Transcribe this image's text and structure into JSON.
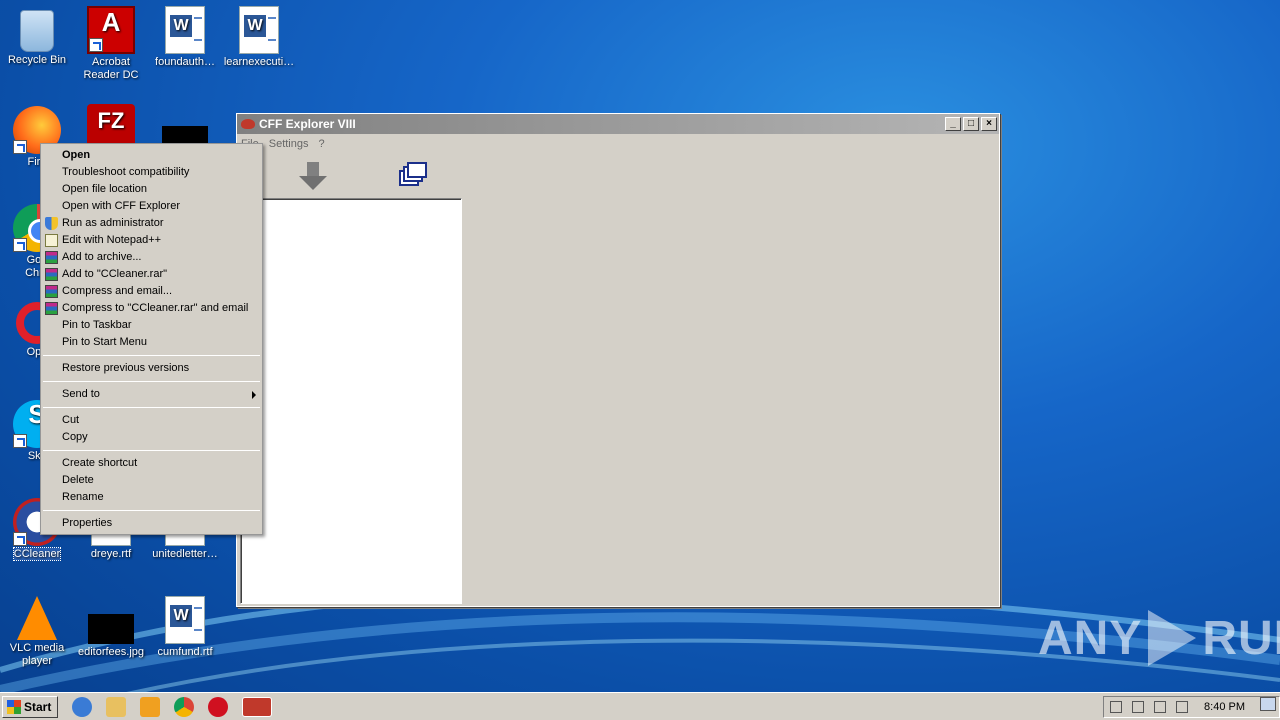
{
  "desktop": {
    "icons": {
      "recycle": "Recycle Bin",
      "acrobat_l1": "Acrobat",
      "acrobat_l2": "Reader DC",
      "foundauth": "foundauth…",
      "learnexec": "learnexecuti…",
      "firefox": "Fire",
      "chrome_l1": "Goo",
      "chrome_l2": "Chro",
      "opera": "Ope",
      "skype": "Sky",
      "ccleaner": "CCleaner",
      "dreye": "dreye.rtf",
      "unitedletter": "unitedletter…",
      "vlc_l1": "VLC media",
      "vlc_l2": "player",
      "editorfees": "editorfees.jpg",
      "cumfund": "cumfund.rtf"
    }
  },
  "window": {
    "title": "CFF Explorer VIII",
    "menu": [
      "File",
      "Settings",
      "?"
    ]
  },
  "context_menu": {
    "items": {
      "open": "Open",
      "troubleshoot": "Troubleshoot compatibility",
      "open_location": "Open file location",
      "open_cff": "Open with CFF Explorer",
      "run_admin": "Run as administrator",
      "edit_npp": "Edit with Notepad++",
      "add_archive": "Add to archive...",
      "add_rar": "Add to \"CCleaner.rar\"",
      "compress_email": "Compress and email...",
      "compress_rar_email": "Compress to \"CCleaner.rar\" and email",
      "pin_taskbar": "Pin to Taskbar",
      "pin_start": "Pin to Start Menu",
      "restore": "Restore previous versions",
      "send_to": "Send to",
      "cut": "Cut",
      "copy": "Copy",
      "create_shortcut": "Create shortcut",
      "delete": "Delete",
      "rename": "Rename",
      "properties": "Properties"
    }
  },
  "taskbar": {
    "start": "Start",
    "clock": "8:40 PM"
  },
  "watermark": {
    "left": "ANY",
    "right": "RUN"
  }
}
